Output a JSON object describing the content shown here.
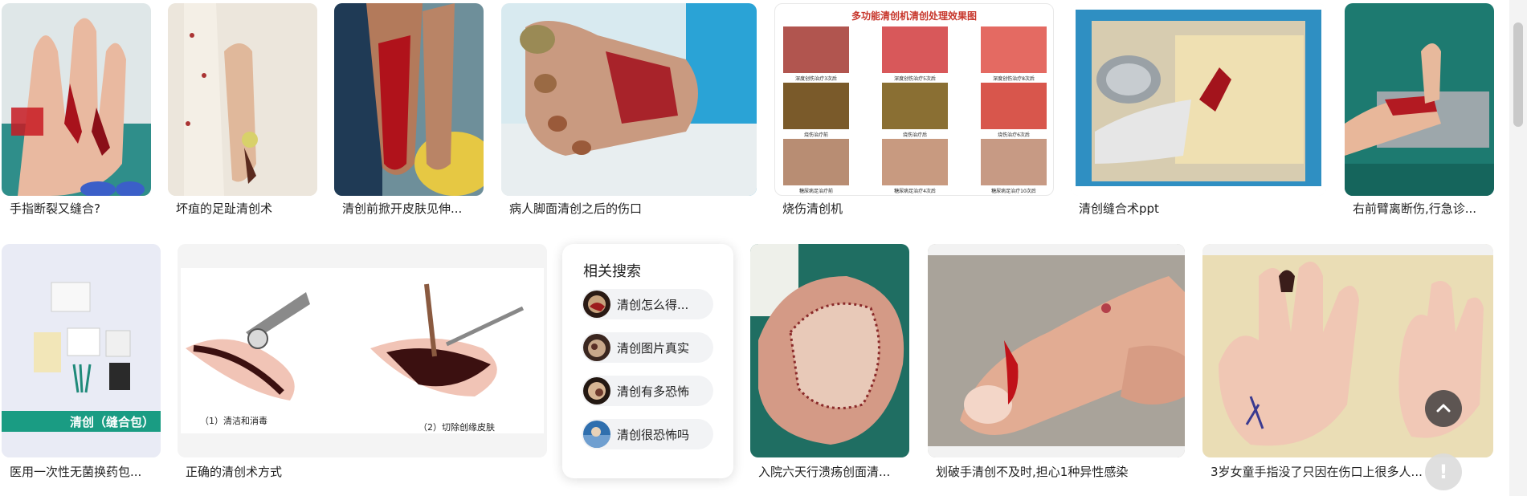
{
  "results": {
    "row1": [
      {
        "caption": "手指断裂又缝合?"
      },
      {
        "caption": "坏疽的足趾清创术"
      },
      {
        "caption": "清创前掀开皮肤见伸..."
      },
      {
        "caption": "病人脚面清创之后的伤口"
      },
      {
        "caption": "烧伤清创机",
        "image_title": "多功能清创机清创处理效果图",
        "image_labels": [
          "深度创伤治疗3次后",
          "深度创伤治疗5次后",
          "深度创伤治疗8次后",
          "烧伤治疗前",
          "烧伤治疗后",
          "烧伤治疗6次后",
          "糖尿病足治疗前",
          "糖尿病足治疗4次后",
          "糖尿病足治疗10次后"
        ]
      },
      {
        "caption": "清创缝合术ppt"
      },
      {
        "caption": "右前臂离断伤,行急诊..."
      }
    ],
    "row2": [
      {
        "caption": "医用一次性无菌换药包...",
        "image_banner": "清创（缝合包）"
      },
      {
        "caption": "正确的清创术方式",
        "image_labels": [
          "（1）清洁和消毒",
          "（2）切除创缘皮肤"
        ]
      },
      {
        "caption": "入院六天行溃疡创面清..."
      },
      {
        "caption": "划破手清创不及时,担心1种异性感染"
      },
      {
        "caption": "3岁女童手指没了只因在伤口上很多人..."
      }
    ]
  },
  "related": {
    "title": "相关搜索",
    "items": [
      {
        "label": "清创怎么得..."
      },
      {
        "label": "清创图片真实"
      },
      {
        "label": "清创有多恐怖"
      },
      {
        "label": "清创很恐怖吗"
      }
    ]
  },
  "icons": {
    "back_to_top": "chevron-up-icon",
    "feedback": "exclamation-icon"
  },
  "colors": {
    "accent_green": "#1a9c83",
    "wound_red": "#b0121b"
  }
}
